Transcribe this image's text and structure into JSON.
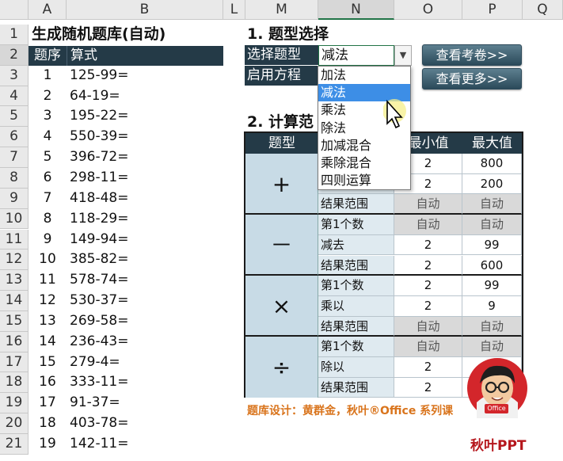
{
  "columns": [
    "A",
    "B",
    "L",
    "M",
    "N",
    "O",
    "P",
    "Q"
  ],
  "selected_column": "N",
  "rows": [
    "1",
    "2",
    "3",
    "4",
    "5",
    "6",
    "7",
    "8",
    "9",
    "10",
    "11",
    "12",
    "13",
    "14",
    "15",
    "16",
    "17",
    "18",
    "19",
    "20",
    "21"
  ],
  "selected_row": "2",
  "left_sheet": {
    "title": "生成随机题库(自动)",
    "header": {
      "index": "题序",
      "formula": "算式"
    },
    "items": [
      {
        "n": "1",
        "f": "125-99="
      },
      {
        "n": "2",
        "f": "64-19="
      },
      {
        "n": "3",
        "f": "195-22="
      },
      {
        "n": "4",
        "f": "550-39="
      },
      {
        "n": "5",
        "f": "396-72="
      },
      {
        "n": "6",
        "f": "298-11="
      },
      {
        "n": "7",
        "f": "418-48="
      },
      {
        "n": "8",
        "f": "118-29="
      },
      {
        "n": "9",
        "f": "149-94="
      },
      {
        "n": "10",
        "f": "385-82="
      },
      {
        "n": "11",
        "f": "578-74="
      },
      {
        "n": "12",
        "f": "530-37="
      },
      {
        "n": "13",
        "f": "269-58="
      },
      {
        "n": "14",
        "f": "236-43="
      },
      {
        "n": "15",
        "f": "279-4="
      },
      {
        "n": "16",
        "f": "333-11="
      },
      {
        "n": "17",
        "f": "91-37="
      },
      {
        "n": "18",
        "f": "403-78="
      },
      {
        "n": "19",
        "f": "142-11="
      }
    ]
  },
  "section1": {
    "heading": "1. 题型选择",
    "select_label": "选择题型",
    "select_value": "减法",
    "equation_label": "启用方程",
    "dropdown_options": [
      "加法",
      "减法",
      "乘法",
      "除法",
      "加减混合",
      "乘除混合",
      "四则运算"
    ],
    "highlighted_option": 1
  },
  "buttons": {
    "exam": "查看考卷>>",
    "more": "查看更多>>"
  },
  "section2": {
    "heading": "2. 计算范",
    "headers": {
      "type": "题型",
      "min": "最小值",
      "max": "最大值"
    },
    "header_min_visible": "最小值",
    "groups": [
      {
        "symbol": "+",
        "rows": [
          {
            "label": "",
            "min": "2",
            "max": "800"
          },
          {
            "label": "",
            "min": "2",
            "max": "200"
          },
          {
            "label": "结果范围",
            "min": "自动",
            "max": "自动"
          }
        ]
      },
      {
        "symbol": "－",
        "rows": [
          {
            "label": "第1个数",
            "min": "自动",
            "max": "自动"
          },
          {
            "label": "减去",
            "min": "2",
            "max": "99"
          },
          {
            "label": "结果范围",
            "min": "2",
            "max": "600"
          }
        ]
      },
      {
        "symbol": "×",
        "rows": [
          {
            "label": "第1个数",
            "min": "2",
            "max": "99"
          },
          {
            "label": "乘以",
            "min": "2",
            "max": "9"
          },
          {
            "label": "结果范围",
            "min": "自动",
            "max": "自动"
          }
        ]
      },
      {
        "symbol": "÷",
        "rows": [
          {
            "label": "第1个数",
            "min": "自动",
            "max": "自动"
          },
          {
            "label": "除以",
            "min": "2",
            "max": ""
          },
          {
            "label": "结果范围",
            "min": "2",
            "max": ""
          }
        ]
      }
    ]
  },
  "caption": "题库设计：黄群金，秋叶®Office 系列课",
  "brand": {
    "name": "秋叶PPT",
    "badge": "Office"
  },
  "colors": {
    "dark_header": "#243a47",
    "light_blue": "#dfeaf0",
    "symbol_blue": "#c8dbe6",
    "auto_gray": "#d9d9d9",
    "accent_orange": "#d9741c",
    "highlight": "#3d8ee6",
    "brand_red": "#d3262b"
  }
}
